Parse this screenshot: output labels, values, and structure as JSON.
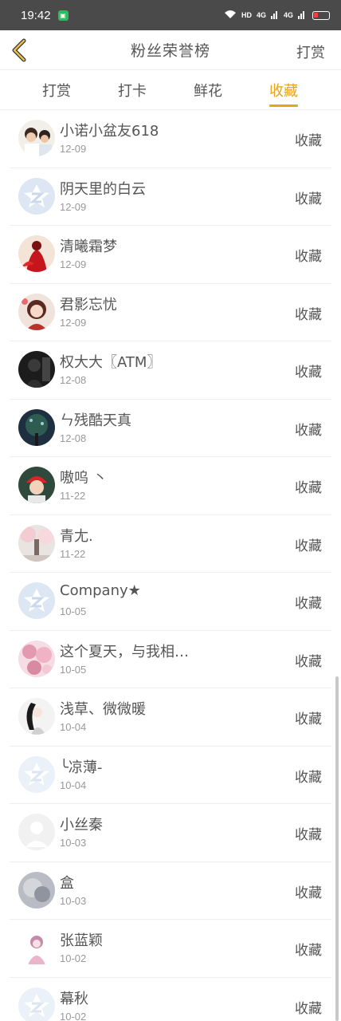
{
  "status_bar": {
    "time": "19:42",
    "hd_label": "HD",
    "net1": "4G",
    "net2": "4G"
  },
  "header": {
    "title": "粉丝荣誉榜",
    "right_action": "打赏"
  },
  "tabs": [
    {
      "label": "打赏",
      "active": false
    },
    {
      "label": "打卡",
      "active": false
    },
    {
      "label": "鲜花",
      "active": false
    },
    {
      "label": "收藏",
      "active": true
    }
  ],
  "colors": {
    "accent": "#e8a21c",
    "statusbar": "#4a4a4a"
  },
  "users": [
    {
      "name": "小诺小盆友618",
      "date": "12-09",
      "action": "收藏",
      "avatar": "photo-kids"
    },
    {
      "name": "阴天里的白云",
      "date": "12-09",
      "action": "收藏",
      "avatar": "default-logo"
    },
    {
      "name": "清曦霜梦",
      "date": "12-09",
      "action": "收藏",
      "avatar": "red-dress"
    },
    {
      "name": "君影忘忧",
      "date": "12-09",
      "action": "收藏",
      "avatar": "anime-girl"
    },
    {
      "name": "权大大〖ATM〗",
      "date": "12-08",
      "action": "收藏",
      "avatar": "dark-portrait"
    },
    {
      "name": "ㄣ残酷天真",
      "date": "12-08",
      "action": "收藏",
      "avatar": "night-tree"
    },
    {
      "name": "嗷呜 丶",
      "date": "11-22",
      "action": "收藏",
      "avatar": "boy-red-hat"
    },
    {
      "name": "青尢.",
      "date": "11-22",
      "action": "收藏",
      "avatar": "blossom-path"
    },
    {
      "name": "Company★",
      "date": "10-05",
      "action": "收藏",
      "avatar": "default-logo"
    },
    {
      "name": "这个夏天，与我相…",
      "date": "10-05",
      "action": "收藏",
      "avatar": "pink-flowers"
    },
    {
      "name": "浅草、微微暖",
      "date": "10-04",
      "action": "收藏",
      "avatar": "ink-lady"
    },
    {
      "name": "╰凉薄-",
      "date": "10-04",
      "action": "收藏",
      "avatar": "default-logo-faded"
    },
    {
      "name": "小丝秦",
      "date": "10-03",
      "action": "收藏",
      "avatar": "default-person"
    },
    {
      "name": "盒",
      "date": "10-03",
      "action": "收藏",
      "avatar": "grey-blur"
    },
    {
      "name": "张蓝颖",
      "date": "10-02",
      "action": "收藏",
      "avatar": "pink-doll"
    },
    {
      "name": "幕秋",
      "date": "10-02",
      "action": "收藏",
      "avatar": "default-logo-faded"
    }
  ]
}
